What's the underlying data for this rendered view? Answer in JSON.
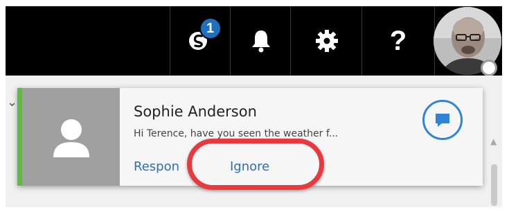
{
  "toolbar": {
    "skype_badge": "1",
    "help_label": "?"
  },
  "notification": {
    "sender": "Sophie Anderson",
    "preview": "Hi Terence, have you seen the weather f...",
    "respond_label": "Respon",
    "ignore_label": "Ignore"
  },
  "colors": {
    "topbar": "#000000",
    "accent_bar": "#5bbf3a",
    "link": "#2f6db5",
    "highlight": "#e8393f",
    "skype_badge": "#1f6fbf"
  }
}
